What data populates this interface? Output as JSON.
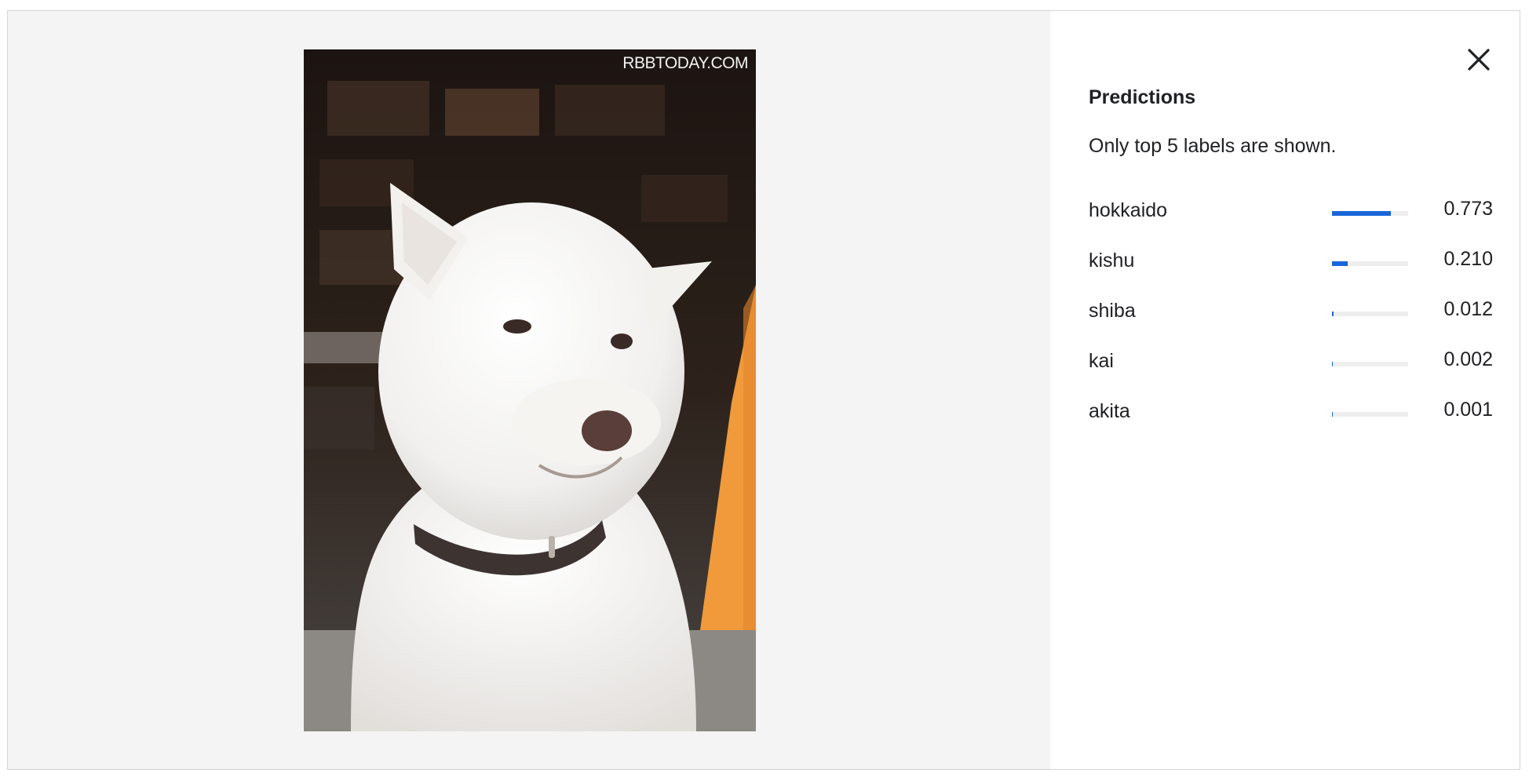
{
  "image_viewer": {
    "watermark": "RBBTODAY.COM",
    "subject": "white-dog-photo"
  },
  "predictions_panel": {
    "close_icon": "close-icon",
    "title": "Predictions",
    "note": "Only top 5 labels are shown.",
    "bar_color": "#1a66d9",
    "track_color": "#eeeeee",
    "items": [
      {
        "label": "hokkaido",
        "score": "0.773",
        "value": 0.773
      },
      {
        "label": "kishu",
        "score": "0.210",
        "value": 0.21
      },
      {
        "label": "shiba",
        "score": "0.012",
        "value": 0.012
      },
      {
        "label": "kai",
        "score": "0.002",
        "value": 0.002
      },
      {
        "label": "akita",
        "score": "0.001",
        "value": 0.001
      }
    ]
  }
}
